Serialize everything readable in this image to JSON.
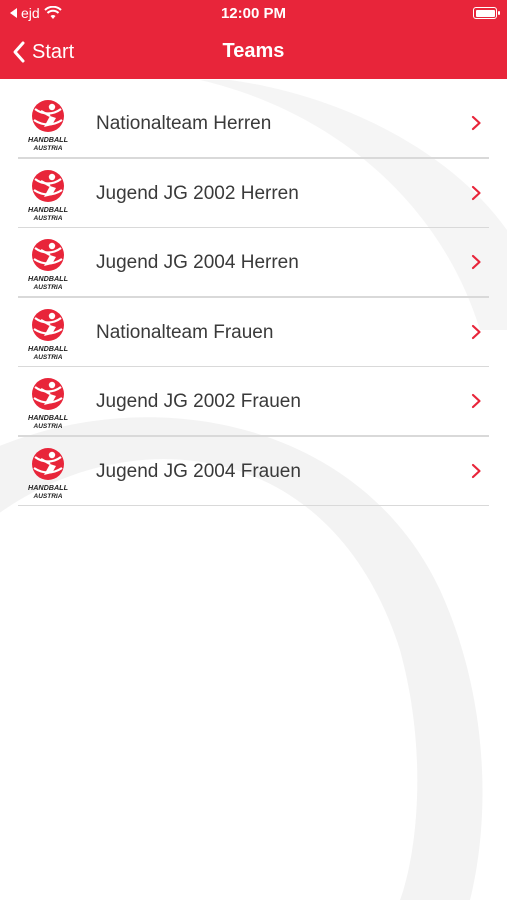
{
  "status_bar": {
    "carrier": "ejd",
    "time": "12:00 PM"
  },
  "nav": {
    "back_label": "Start",
    "title": "Teams"
  },
  "teams": [
    {
      "name": "Nationalteam Herren",
      "logo_text_top": "HANDBALL",
      "logo_text_bottom": "AUSTRIA"
    },
    {
      "name": "Jugend JG 2002 Herren",
      "logo_text_top": "HANDBALL",
      "logo_text_bottom": "AUSTRIA"
    },
    {
      "name": "Jugend JG 2004 Herren",
      "logo_text_top": "HANDBALL",
      "logo_text_bottom": "AUSTRIA"
    },
    {
      "name": "Nationalteam Frauen",
      "logo_text_top": "HANDBALL",
      "logo_text_bottom": "AUSTRIA"
    },
    {
      "name": "Jugend JG 2002 Frauen",
      "logo_text_top": "HANDBALL",
      "logo_text_bottom": "AUSTRIA"
    },
    {
      "name": "Jugend JG 2004 Frauen",
      "logo_text_top": "HANDBALL",
      "logo_text_bottom": "AUSTRIA"
    }
  ],
  "colors": {
    "brand_red": "#e8253a",
    "chevron": "#e8253a",
    "text": "#3a3a3a",
    "divider": "#d9d9d9"
  },
  "icons": {
    "back": "chevron-left-icon",
    "row_disclosure": "chevron-right-icon",
    "team_logo": "handball-austria-logo"
  }
}
